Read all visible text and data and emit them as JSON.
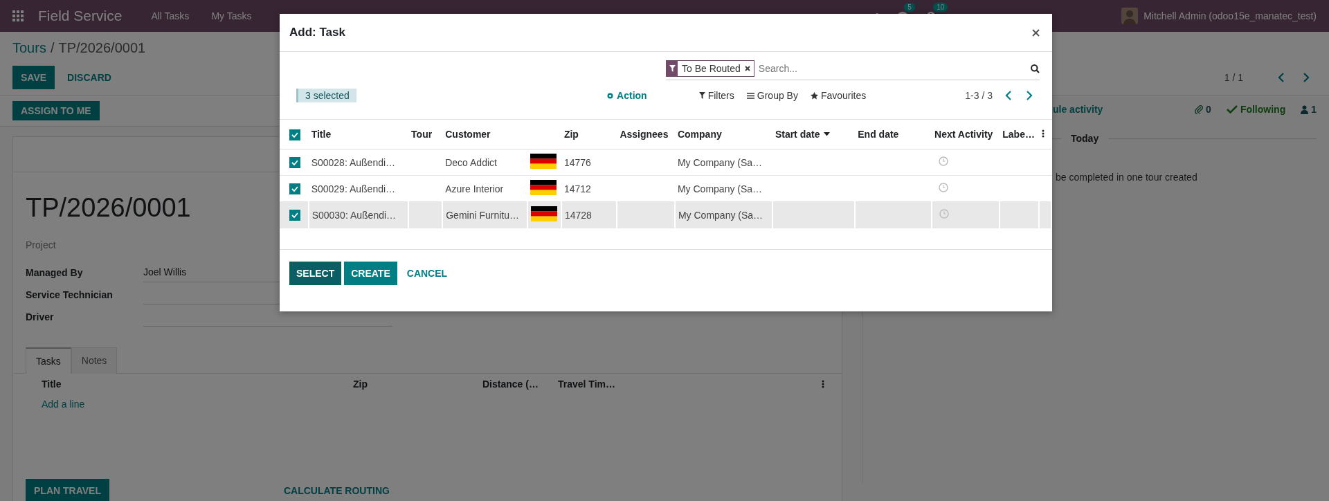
{
  "navbar": {
    "app_name": "Field Service",
    "menu": [
      "All Tasks",
      "My Tasks"
    ],
    "messages_count": "5",
    "activities_count": "10",
    "user": "Mitchell Admin (odoo15e_manatec_test)"
  },
  "breadcrumb": {
    "parent": "Tours",
    "separator": "/",
    "current": "TP/2026/0001"
  },
  "form_buttons": [
    {
      "label": "SAVE",
      "kind": "primary"
    },
    {
      "label": "DISCARD",
      "kind": "link"
    }
  ],
  "pager": "1 / 1",
  "status_buttons": [
    "ASSIGN TO ME"
  ],
  "record": {
    "name": "TP/2026/0001",
    "project_label": "Project",
    "fields": [
      {
        "label": "Managed By",
        "value": "Joel Willis"
      },
      {
        "label": "Service Technician"
      },
      {
        "label": "Driver"
      }
    ]
  },
  "tabs": [
    {
      "label": "Tasks",
      "selected": true
    },
    {
      "label": "Notes",
      "selected": false
    }
  ],
  "task_lines": {
    "columns": [
      "Title",
      "Zip",
      "Distance (…",
      "Travel Tim…"
    ],
    "add_line": "Add a line"
  },
  "bottom_buttons": [
    {
      "label": "PLAN TRAVEL",
      "kind": "primary"
    },
    {
      "label": "CALCULATE ROUTING",
      "kind": "link"
    }
  ],
  "chatter": {
    "schedule": "ule activity",
    "attachments": "0",
    "follow": "Following",
    "followers": "1",
    "date_separator": "Today",
    "message": "be completed in one tour created"
  },
  "dialog": {
    "title": "Add: Task",
    "facet": "To Be Routed",
    "search_placeholder": "Search...",
    "selected_badge": "3 selected",
    "action": "Action",
    "filters": "Filters",
    "group_by": "Group By",
    "favourites": "Favourites",
    "pager": "1-3 / 3",
    "all_checked": true,
    "columns": [
      {
        "label": "Title",
        "sorted": false
      },
      {
        "label": "Tour",
        "sorted": false
      },
      {
        "label": "Customer",
        "sorted": false
      },
      {
        "label": "Zip",
        "sorted": false
      },
      {
        "label": "Assignees",
        "sorted": false
      },
      {
        "label": "Company",
        "sorted": false
      },
      {
        "label": "Start date",
        "sorted": true
      },
      {
        "label": "End date",
        "sorted": false
      },
      {
        "label": "Next Activity",
        "sorted": false
      },
      {
        "label": "Labe…",
        "sorted": false
      }
    ],
    "rows": [
      {
        "selected": true,
        "highlighted": false,
        "title": "S00028: Außendi…",
        "customer": "Deco Addict",
        "zip": "14776",
        "company": "My Company (Sa…"
      },
      {
        "selected": true,
        "highlighted": false,
        "title": "S00029: Außendi…",
        "customer": "Azure Interior",
        "zip": "14712",
        "company": "My Company (Sa…"
      },
      {
        "selected": true,
        "highlighted": true,
        "title": "S00030: Außendi…",
        "customer": "Gemini Furnitu…",
        "zip": "14728",
        "company": "My Company (Sa…"
      }
    ],
    "buttons": [
      {
        "label": "SELECT",
        "kind": "dark"
      },
      {
        "label": "CREATE",
        "kind": "primary"
      },
      {
        "label": "CANCEL",
        "kind": "link"
      }
    ]
  }
}
